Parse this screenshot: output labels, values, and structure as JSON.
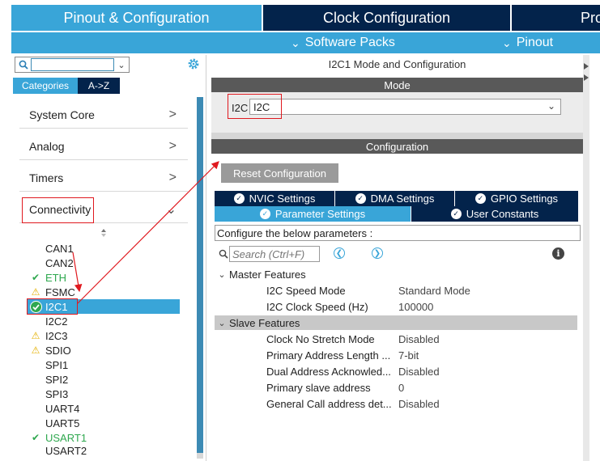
{
  "top_tabs": {
    "pinout": "Pinout & Configuration",
    "clock": "Clock Configuration",
    "project": "Pro"
  },
  "sub_bar": {
    "software_packs": "Software Packs",
    "pinout": "Pinout"
  },
  "left": {
    "search": {
      "value": "",
      "placeholder": ""
    },
    "view_tabs": {
      "categories": "Categories",
      "atoz": "A->Z"
    },
    "categories": [
      {
        "label": "System Core",
        "arrow": ">"
      },
      {
        "label": "Analog",
        "arrow": ">"
      },
      {
        "label": "Timers",
        "arrow": ">"
      },
      {
        "label": "Connectivity",
        "arrow": "⌄"
      }
    ],
    "peripherals": [
      {
        "name": "CAN1",
        "status": "none"
      },
      {
        "name": "CAN2",
        "status": "none"
      },
      {
        "name": "ETH",
        "status": "ok"
      },
      {
        "name": "FSMC",
        "status": "warn"
      },
      {
        "name": "I2C1",
        "status": "ok-selected"
      },
      {
        "name": "I2C2",
        "status": "none"
      },
      {
        "name": "I2C3",
        "status": "warn"
      },
      {
        "name": "SDIO",
        "status": "warn"
      },
      {
        "name": "SPI1",
        "status": "none"
      },
      {
        "name": "SPI2",
        "status": "none"
      },
      {
        "name": "SPI3",
        "status": "none"
      },
      {
        "name": "UART4",
        "status": "none"
      },
      {
        "name": "UART5",
        "status": "none"
      },
      {
        "name": "USART1",
        "status": "ok"
      },
      {
        "name": "USART2",
        "status": "none"
      }
    ]
  },
  "right": {
    "title": "I2C1 Mode and Configuration",
    "mode_header": "Mode",
    "mode_label": "I2C",
    "mode_value": "I2C",
    "config_header": "Configuration",
    "reset_button": "Reset Configuration",
    "tabs": {
      "nvic": "NVIC Settings",
      "dma": "DMA Settings",
      "gpio": "GPIO Settings",
      "param": "Parameter Settings",
      "user": "User Constants"
    },
    "hint": "Configure the below parameters :",
    "param_search_placeholder": "Search (Ctrl+F)",
    "groups": {
      "master": "Master Features",
      "slave": "Slave Features"
    },
    "master_params": [
      {
        "name": "I2C Speed Mode",
        "value": "Standard Mode"
      },
      {
        "name": "I2C Clock Speed (Hz)",
        "value": "100000"
      }
    ],
    "slave_params": [
      {
        "name": "Clock No Stretch Mode",
        "value": "Disabled"
      },
      {
        "name": "Primary Address Length ...",
        "value": "7-bit"
      },
      {
        "name": "Dual Address Acknowled...",
        "value": "Disabled"
      },
      {
        "name": "Primary slave address",
        "value": "0"
      },
      {
        "name": "General Call address det...",
        "value": "Disabled"
      }
    ]
  },
  "colors": {
    "accent": "#39a5d8",
    "navy": "#03234b",
    "ok": "#2fa84f",
    "warn": "#e4b000",
    "annotation": "#e0191f"
  }
}
